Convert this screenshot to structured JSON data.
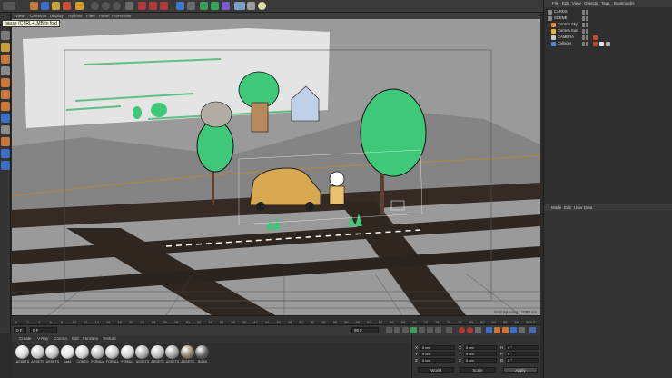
{
  "tooltip": "pause (CTRL+LMB to fold",
  "viewport": {
    "menu": [
      "View",
      "Cameras",
      "Display",
      "Options",
      "Filter",
      "Panel",
      "ProRender"
    ],
    "grid_spacing": "Grid Spacing : 1000 cm"
  },
  "timeline": {
    "ticks": [
      "0",
      "2",
      "4",
      "6",
      "8",
      "10",
      "12",
      "14",
      "16",
      "18",
      "20",
      "22",
      "24",
      "26",
      "28",
      "30",
      "32",
      "34",
      "36",
      "38",
      "40",
      "42",
      "44",
      "46",
      "48",
      "50",
      "52",
      "54",
      "56",
      "58",
      "60",
      "62",
      "64",
      "66",
      "68",
      "70",
      "72",
      "74",
      "76",
      "78",
      "80",
      "82",
      "84",
      "86",
      "88",
      "90"
    ],
    "current_frame": "0 F"
  },
  "playback": {
    "start_field": "0 F",
    "end_field": "90 F",
    "min_field": "0 F"
  },
  "material_manager": {
    "menu": [
      "Create",
      "V-Ray",
      "Corona",
      "Edit",
      "Function",
      "Texture"
    ],
    "materials": [
      "ASSETS",
      "ASSETS",
      "ASSETS",
      "Light",
      "CONTO",
      "FORALL",
      "FORALL",
      "FORALL",
      "ASSETS",
      "ASSETS",
      "ASSETS",
      "ASSETS",
      "ROAD"
    ]
  },
  "coordinates": {
    "rows": [
      {
        "axis": "X",
        "pos": "0 cm",
        "axis2": "X",
        "size": "0 cm",
        "axis3": "H",
        "rot": "0 °"
      },
      {
        "axis": "Y",
        "pos": "0 cm",
        "axis2": "Y",
        "size": "0 cm",
        "axis3": "P",
        "rot": "0 °"
      },
      {
        "axis": "Z",
        "pos": "0 cm",
        "axis2": "Z",
        "size": "0 cm",
        "axis3": "B",
        "rot": "0 °"
      }
    ],
    "world_label": "World",
    "scale_label": "Scale",
    "apply_label": "Apply"
  },
  "object_manager": {
    "menu": [
      "File",
      "Edit",
      "View",
      "Objects",
      "Tags",
      "Bookmarks"
    ],
    "objects": [
      {
        "name": "CARDS",
        "indent": 0,
        "color": "#8a8a8a"
      },
      {
        "name": "SCENE",
        "indent": 0,
        "color": "#8a8a8a"
      },
      {
        "name": "Corona Sky",
        "indent": 4,
        "color": "#e08a3a"
      },
      {
        "name": "Corona Sun",
        "indent": 4,
        "color": "#e0b43a"
      },
      {
        "name": "CAMERA",
        "indent": 4,
        "color": "#c8c8c8"
      },
      {
        "name": "Cylinder",
        "indent": 4,
        "color": "#4a8ae0"
      }
    ]
  },
  "attribute_manager": {
    "menu": [
      "Mode",
      "Edit",
      "User Data"
    ]
  }
}
